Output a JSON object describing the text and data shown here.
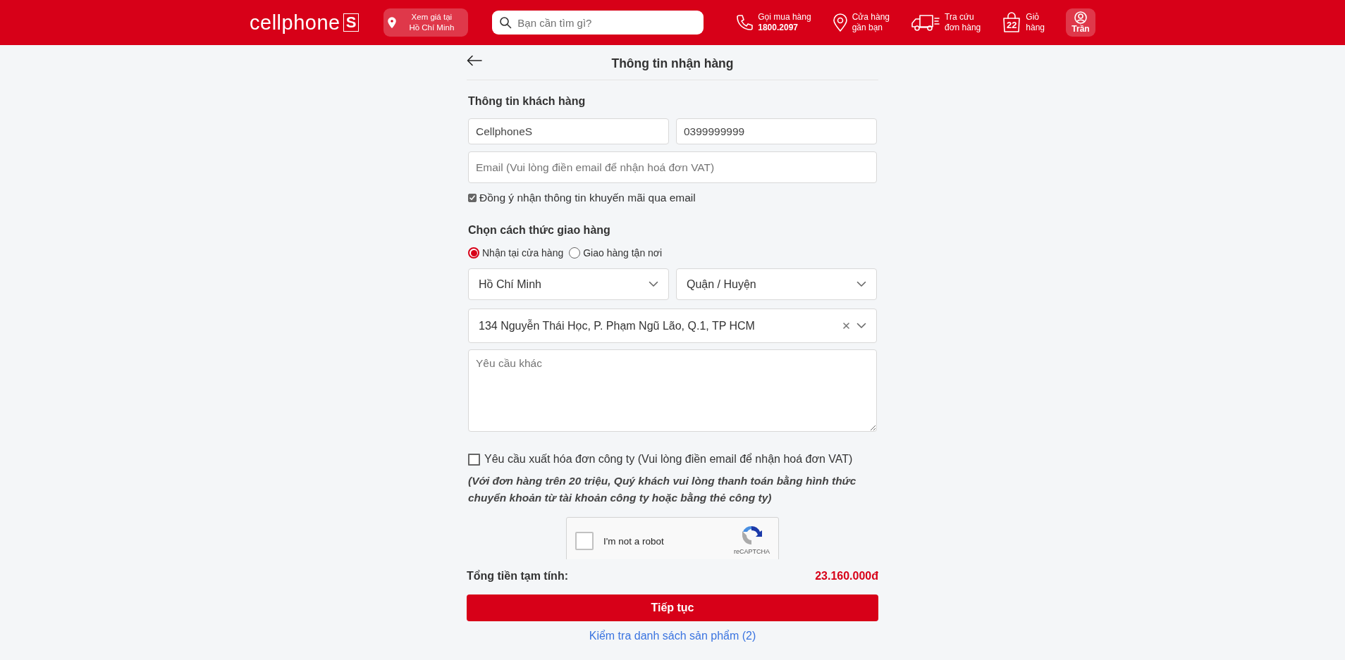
{
  "header": {
    "logo": {
      "text": "cellphone",
      "mark": "S"
    },
    "location": {
      "line1": "Xem giá tại",
      "line2": "Hồ Chí Minh"
    },
    "search": {
      "placeholder": "Bạn cần tìm gì?"
    },
    "links": [
      {
        "kind": "phone",
        "line1": "Gọi mua hàng",
        "line2": "1800.2097"
      },
      {
        "kind": "store",
        "line1": "Cửa hàng",
        "line2": "gần bạn"
      },
      {
        "kind": "tracking",
        "line1": "Tra cứu",
        "line2": "đơn hàng"
      },
      {
        "kind": "cart",
        "line1": "Giỏ",
        "line2": "hàng",
        "count": "22"
      }
    ],
    "account": {
      "label": "Trần"
    }
  },
  "page": {
    "title": "Thông tin nhận hàng"
  },
  "customer": {
    "heading": "Thông tin khách hàng",
    "name": {
      "value": "CellphoneS"
    },
    "phone": {
      "value": "0399999999"
    },
    "email": {
      "placeholder": "Email (Vui lòng điền email để nhận hoá đơn VAT)"
    },
    "promo": {
      "label": "Đồng ý nhận thông tin khuyến mãi qua email",
      "checked": true
    }
  },
  "delivery": {
    "heading": "Chọn cách thức giao hàng",
    "options": [
      {
        "label": "Nhận tại cửa hàng",
        "selected": true
      },
      {
        "label": "Giao hàng tận nơi",
        "selected": false
      }
    ],
    "selects": [
      {
        "text": "Hồ Chí Minh",
        "clearable": false
      },
      {
        "text": "Quận / Huyện",
        "clearable": false
      }
    ],
    "store": {
      "text": "134 Nguyễn Thái Học, P. Phạm Ngũ Lão, Q.1, TP HCM",
      "clearable": true
    },
    "note": {
      "placeholder": "Yêu cầu khác"
    }
  },
  "invoice": {
    "label": "Yêu cầu xuất hóa đơn công ty (Vui lòng điền email để nhận hoá đơn VAT)",
    "checked": false,
    "notice": "(Với đơn hàng trên 20 triệu, Quý khách vui lòng thanh toán bằng hình thức chuyển khoản từ tài khoản công ty hoặc bằng thẻ công ty)"
  },
  "captcha": {
    "label": "I'm not a robot",
    "brand": "reCAPTCHA",
    "checked": false
  },
  "summary": {
    "label": "Tổng tiền tạm tính:",
    "total": "23.160.000đ",
    "button": "Tiếp tục",
    "link": "Kiểm tra danh sách sản phẩm (2)"
  }
}
